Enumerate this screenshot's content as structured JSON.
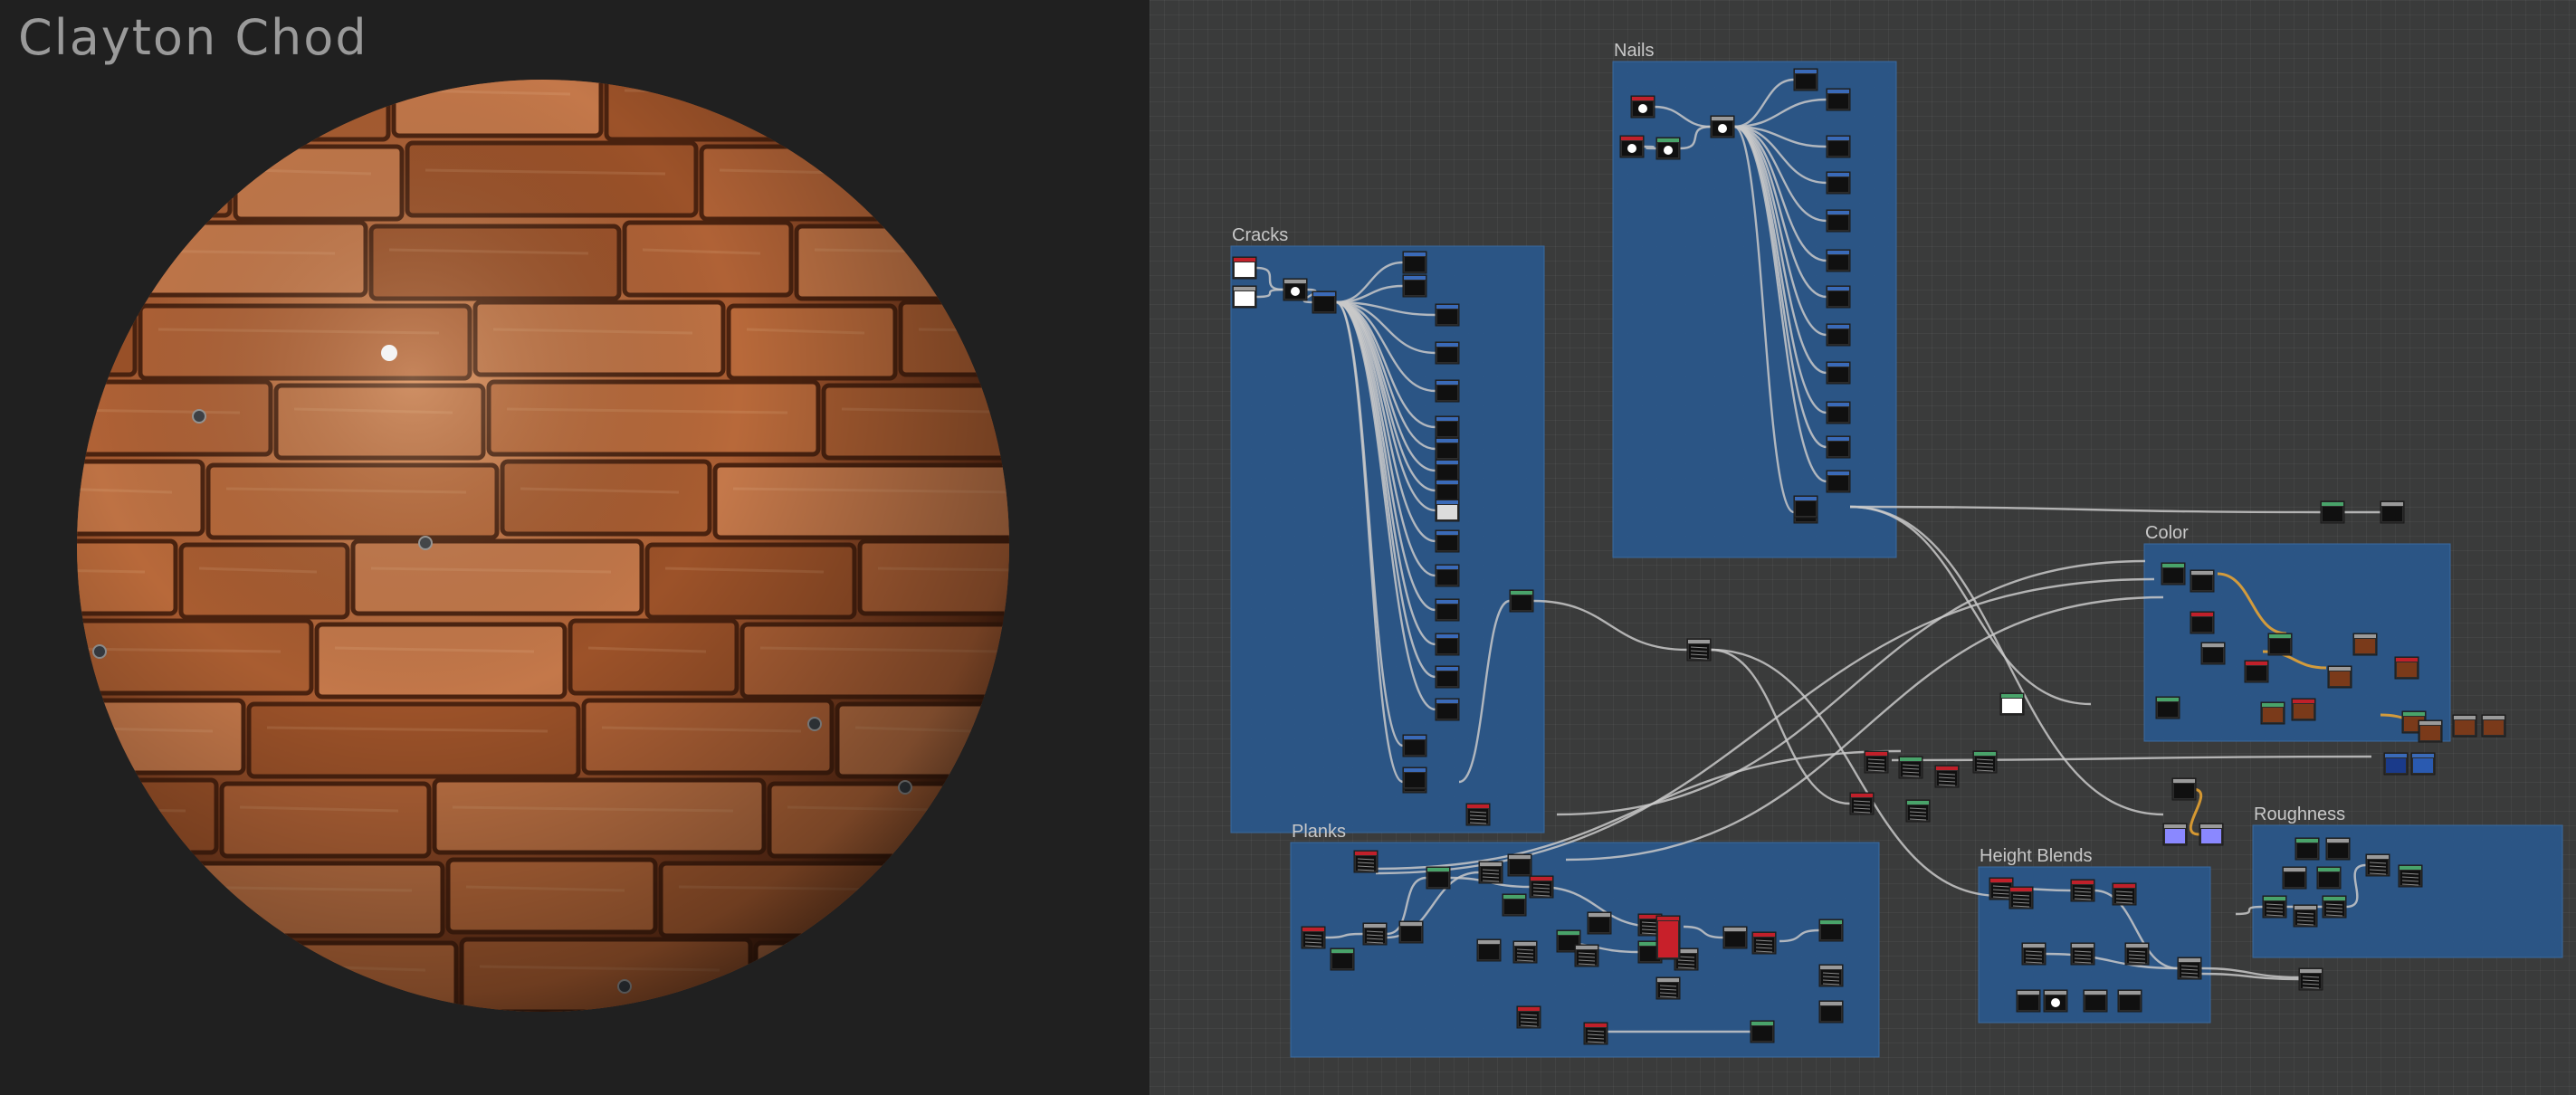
{
  "author": "Clayton Chod",
  "preview": {
    "subject": "sphere-material-preview",
    "material": "wood-planks"
  },
  "graph": {
    "frames": [
      {
        "id": "nails",
        "title": "Nails"
      },
      {
        "id": "cracks",
        "title": "Cracks"
      },
      {
        "id": "color",
        "title": "Color"
      },
      {
        "id": "planks",
        "title": "Planks"
      },
      {
        "id": "height-blends",
        "title": "Height Blends"
      },
      {
        "id": "roughness",
        "title": "Roughness"
      }
    ]
  },
  "colors": {
    "frame_fill": "#2a5689",
    "wire": "#c9c9c9",
    "wire_highlight": "#f0a830",
    "node_bg": "#101010",
    "header_green": "#49a36a",
    "header_red": "#c0202a",
    "header_gray": "#9a9a9a",
    "header_blue": "#3a6ab8"
  }
}
